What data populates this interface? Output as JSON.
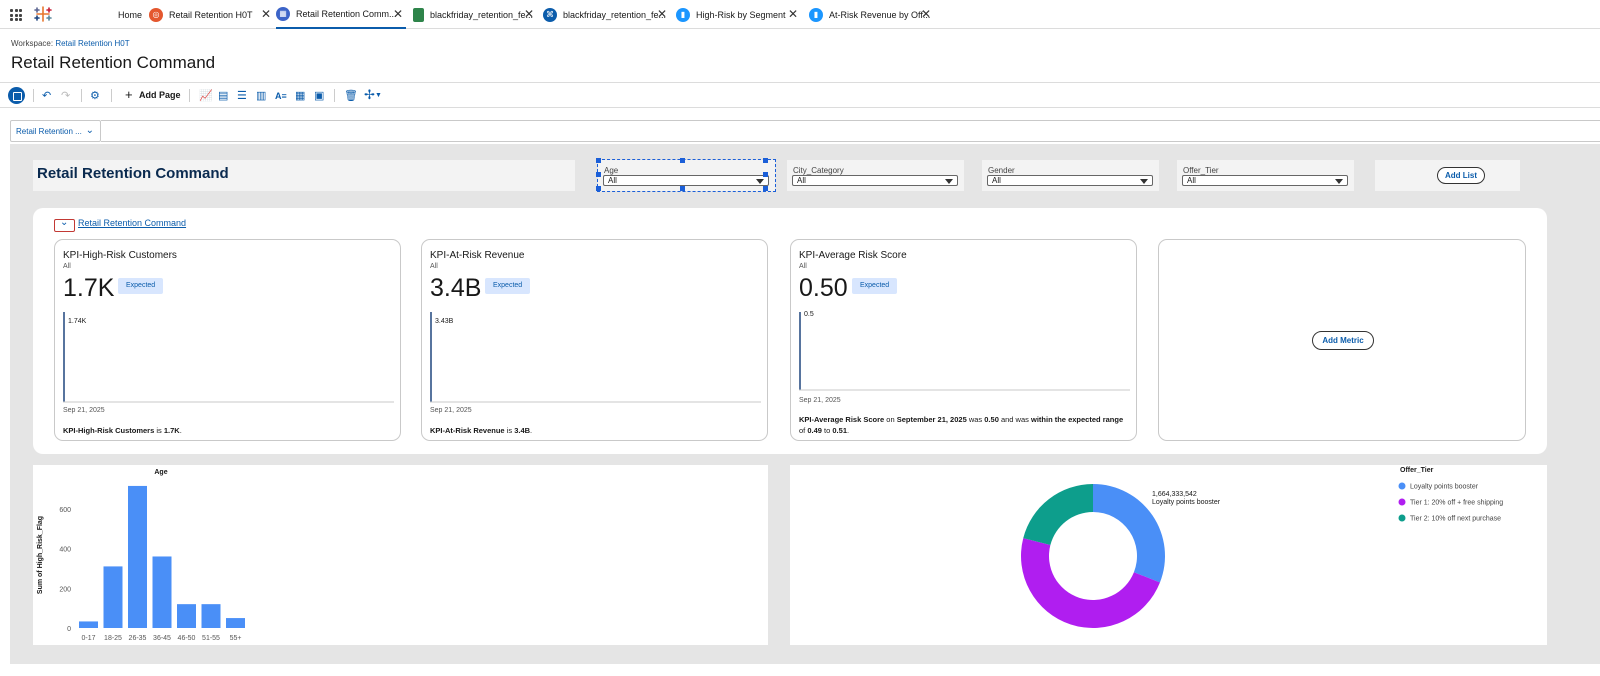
{
  "tabs": [
    {
      "label": "Home",
      "icon": "home",
      "color": ""
    },
    {
      "label": "Retail Retention H0T",
      "icon": "workspace-icon",
      "color": "#e4572e"
    },
    {
      "label": "Retail Retention Comm...",
      "icon": "dashboard-icon",
      "color": "#3c64c8"
    },
    {
      "label": "blackfriday_retention_fe...",
      "icon": "csv-file-icon",
      "color": "#2e844a"
    },
    {
      "label": "blackfriday_retention_fe...",
      "icon": "data-model-icon",
      "color": "#0b5cab"
    },
    {
      "label": "High-Risk by Segment",
      "icon": "viz-icon",
      "color": "#1b96ff"
    },
    {
      "label": "At-Risk Revenue by Off...",
      "icon": "viz-icon",
      "color": "#1b96ff"
    }
  ],
  "workspace": {
    "prefix": "Workspace:",
    "name": "Retail Retention H0T"
  },
  "page_title": "Retail Retention Command",
  "toolbar": {
    "add_page": "Add Page"
  },
  "page_selector": "Retail Retention ...",
  "dashboard": {
    "title": "Retail Retention Command",
    "filters": [
      {
        "label": "Age",
        "value": "All"
      },
      {
        "label": "City_Category",
        "value": "All"
      },
      {
        "label": "Gender",
        "value": "All"
      },
      {
        "label": "Offer_Tier",
        "value": "All"
      }
    ],
    "add_list": "Add List",
    "kpi_section_link": "Retail Retention Command",
    "add_metric": "Add Metric",
    "kpis": [
      {
        "title": "KPI-High-Risk Customers",
        "sub": "All",
        "value": "1.7K",
        "badge": "Expected",
        "spark_label": "1.74K",
        "date": "Sep 21, 2025",
        "desc": [
          {
            "t": "KPI-High-Risk Customers",
            "b": true
          },
          {
            "t": " is ",
            "b": false
          },
          {
            "t": "1.7K",
            "b": true
          },
          {
            "t": ".",
            "b": false
          }
        ]
      },
      {
        "title": "KPI-At-Risk Revenue",
        "sub": "All",
        "value": "3.4B",
        "badge": "Expected",
        "spark_label": "3.43B",
        "date": "Sep 21, 2025",
        "desc": [
          {
            "t": "KPI-At-Risk Revenue",
            "b": true
          },
          {
            "t": " is ",
            "b": false
          },
          {
            "t": "3.4B",
            "b": true
          },
          {
            "t": ".",
            "b": false
          }
        ]
      },
      {
        "title": "KPI-Average Risk Score",
        "sub": "All",
        "value": "0.50",
        "badge": "Expected",
        "spark_label": "0.5",
        "date": "Sep 21, 2025",
        "desc": [
          {
            "t": "KPI-Average Risk Score",
            "b": true
          },
          {
            "t": " on ",
            "b": false
          },
          {
            "t": "September 21, 2025",
            "b": true
          },
          {
            "t": " was ",
            "b": false
          },
          {
            "t": "0.50",
            "b": true
          },
          {
            "t": " and was ",
            "b": false
          },
          {
            "t": "within the expected",
            "b": true
          },
          {
            "t": " ",
            "b": false
          },
          {
            "t": "range",
            "b": true
          },
          {
            "t": " of ",
            "b": false
          },
          {
            "t": "0.49",
            "b": true
          },
          {
            "t": " to ",
            "b": false
          },
          {
            "t": "0.51",
            "b": true
          },
          {
            "t": ".",
            "b": false
          }
        ]
      }
    ]
  },
  "chart_data": [
    {
      "type": "bar",
      "title": "Age",
      "xlabel": "",
      "ylabel": "Sum of High_Risk_Flag",
      "categories": [
        "0-17",
        "18-25",
        "26-35",
        "36-45",
        "46-50",
        "51-55",
        "55+"
      ],
      "values": [
        33,
        310,
        715,
        360,
        120,
        120,
        50
      ],
      "ylim": [
        0,
        760
      ],
      "yticks": [
        0,
        200,
        400,
        600
      ],
      "color": "#4a8ff7"
    },
    {
      "type": "pie",
      "title": "",
      "legend_title": "Offer_Tier",
      "legend_position": "top-right",
      "categories": [
        "Loyalty points booster",
        "Tier 1: 20% off + free shipping",
        "Tier 2: 10% off next purchase"
      ],
      "values": [
        31,
        48,
        21
      ],
      "colors": [
        "#4a8ff7",
        "#b01ef0",
        "#0d9e8c"
      ],
      "annotation": {
        "value": "1,664,333,542",
        "label": "Loyalty points booster"
      }
    }
  ]
}
